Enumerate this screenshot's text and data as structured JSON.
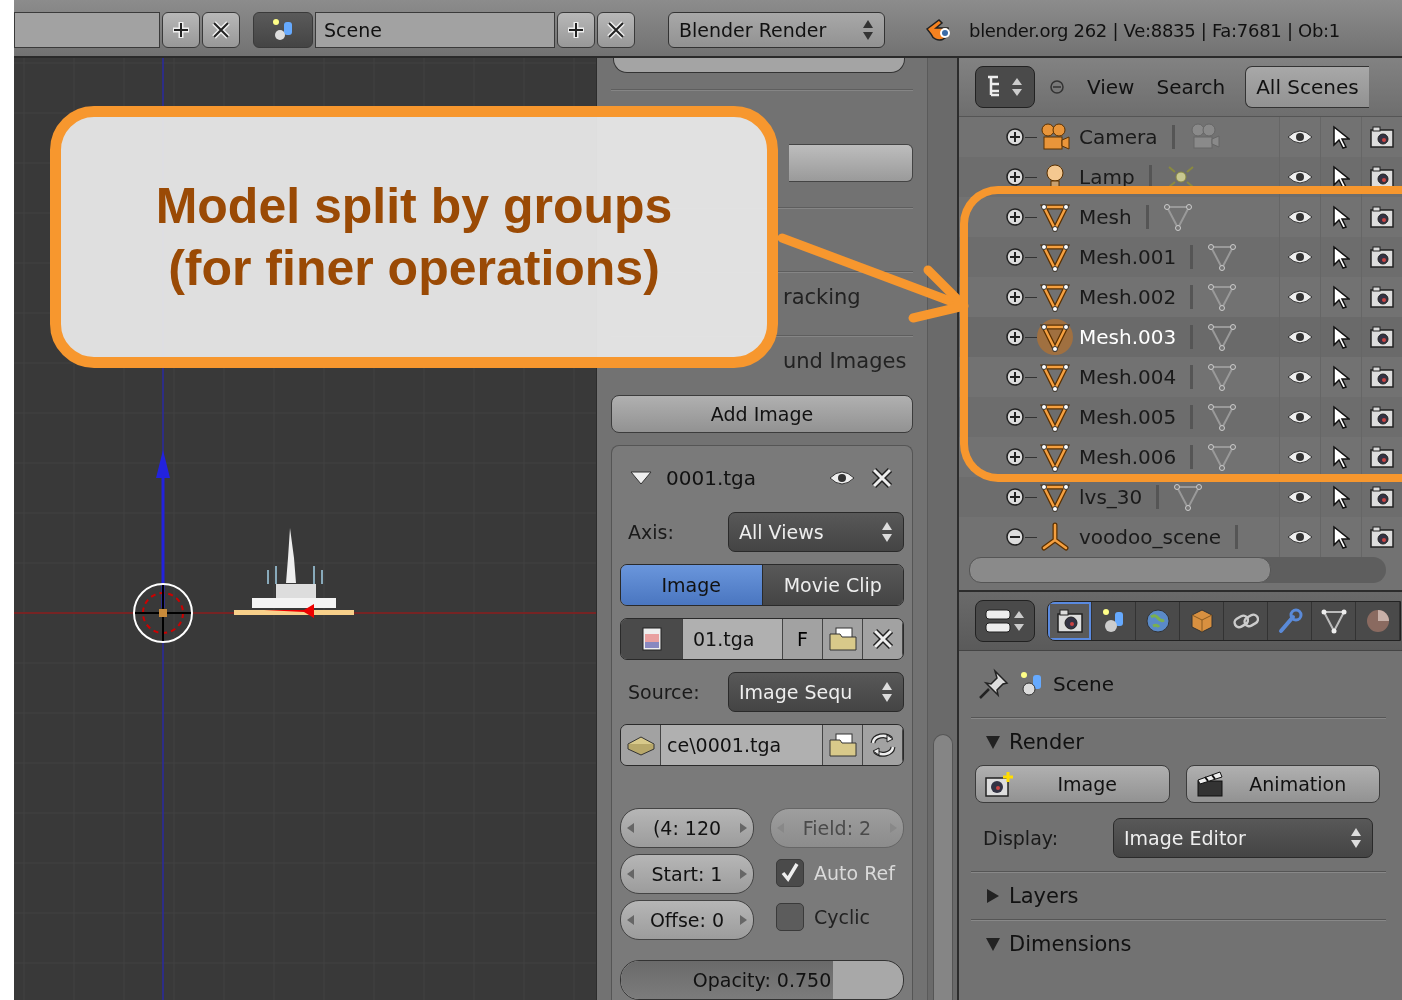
{
  "header": {
    "scene_name": "Scene",
    "render_engine": "Blender Render",
    "stats": "blender.org 262 | Ve:8835 | Fa:7681 | Ob:1"
  },
  "callout": {
    "lines": [
      "Model split by groups",
      "(for finer operations)"
    ]
  },
  "sidebar": {
    "panels": [
      {
        "title": "racking"
      },
      {
        "title": "und Images"
      }
    ],
    "add_button": "Add Image",
    "image": {
      "name": "0001.tga",
      "expanded": true,
      "axis_label": "Axis:",
      "axis_value": "All Views",
      "source_tabs": [
        {
          "label": "Image",
          "selected": true
        },
        {
          "label": "Movie Clip",
          "selected": false
        }
      ],
      "file_name": "01.tga",
      "fake_user": "F",
      "source_label": "Source:",
      "source_value": "Image Sequ",
      "file_path": "ce\\0001.tga",
      "left_fields": [
        {
          "text": "(4: 120",
          "disabled": false
        },
        {
          "text": "Start: 1",
          "disabled": false
        },
        {
          "text": "Offse: 0",
          "disabled": false
        }
      ],
      "right_options": [
        {
          "kind": "number",
          "text": "Field: 2",
          "disabled": true
        },
        {
          "kind": "checkbox",
          "text": "Auto Ref",
          "checked": true,
          "disabled": true
        },
        {
          "kind": "checkbox",
          "text": "Cyclic",
          "checked": false,
          "disabled": false
        }
      ],
      "opacity": {
        "text": "Opacity: 0.750",
        "level": 0.75
      }
    }
  },
  "outliner": {
    "menus": [
      "View",
      "Search"
    ],
    "scene_filter": "All Scenes",
    "rows": [
      {
        "name": "Camera",
        "kind": "camera",
        "expanded": false,
        "selected": false
      },
      {
        "name": "Lamp",
        "kind": "lamp",
        "expanded": false,
        "selected": false
      },
      {
        "name": "Mesh",
        "kind": "mesh",
        "expanded": false,
        "selected": false
      },
      {
        "name": "Mesh.001",
        "kind": "mesh",
        "expanded": false,
        "selected": false
      },
      {
        "name": "Mesh.002",
        "kind": "mesh",
        "expanded": false,
        "selected": false
      },
      {
        "name": "Mesh.003",
        "kind": "mesh",
        "expanded": false,
        "selected": true
      },
      {
        "name": "Mesh.004",
        "kind": "mesh",
        "expanded": false,
        "selected": false
      },
      {
        "name": "Mesh.005",
        "kind": "mesh",
        "expanded": false,
        "selected": false
      },
      {
        "name": "Mesh.006",
        "kind": "mesh",
        "expanded": false,
        "selected": false
      },
      {
        "name": "lvs_30",
        "kind": "mesh",
        "expanded": false,
        "selected": false
      },
      {
        "name": "voodoo_scene",
        "kind": "empty",
        "expanded": true,
        "selected": false
      }
    ]
  },
  "properties": {
    "tabs": [
      {
        "kind": "render",
        "selected": true
      },
      {
        "kind": "scene",
        "selected": false
      },
      {
        "kind": "world",
        "selected": false
      },
      {
        "kind": "object",
        "selected": false
      },
      {
        "kind": "constraints",
        "selected": false
      },
      {
        "kind": "modifiers",
        "selected": false
      },
      {
        "kind": "data",
        "selected": false
      },
      {
        "kind": "material",
        "selected": false
      }
    ],
    "breadcrumb": "Scene",
    "panels": [
      {
        "title": "Render",
        "expanded": true,
        "buttons": [
          {
            "label": "Image",
            "kind": "still"
          },
          {
            "label": "Animation",
            "kind": "animation"
          }
        ],
        "display_label": "Display:",
        "display_value": "Image Editor"
      },
      {
        "title": "Layers",
        "expanded": false
      },
      {
        "title": "Dimensions",
        "expanded": true
      }
    ]
  }
}
